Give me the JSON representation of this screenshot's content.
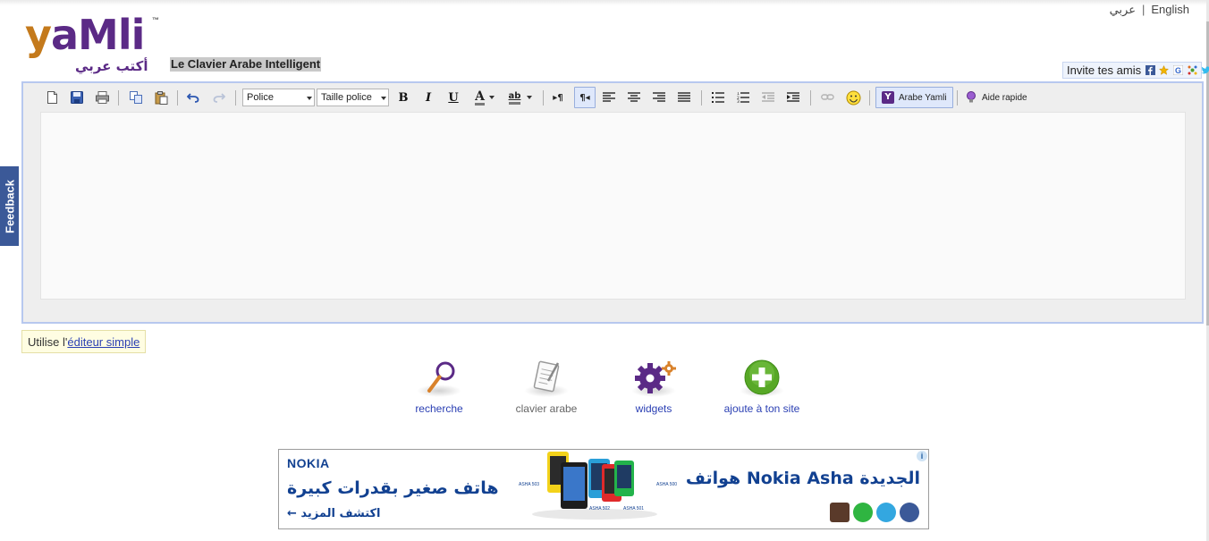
{
  "lang": {
    "arabic": "عربي",
    "separator": "|",
    "english": "English"
  },
  "logo": {
    "y": "y",
    "rest": "aMli",
    "tm": "™",
    "arabic": "أكتب عربي"
  },
  "tagline": "Le Clavier Arabe Intelligent",
  "invite": {
    "label": "Invite tes amis",
    "icons": [
      "facebook-icon",
      "star-icon",
      "google-icon",
      "share-icon",
      "twitter-icon"
    ]
  },
  "toolbar": {
    "font_select": "Police",
    "size_select": "Taille police",
    "bold": "B",
    "italic": "I",
    "underline": "U",
    "font_color": "A",
    "highlight": "ab",
    "yamli_button": "Arabe Yamli",
    "yamli_logo": "Y",
    "help_button": "Aide rapide",
    "icons": [
      "new-document-icon",
      "save-icon",
      "print-icon",
      "copy-icon",
      "paste-icon",
      "undo-icon",
      "redo-icon",
      "ltr-icon",
      "rtl-icon",
      "align-left-icon",
      "align-center-icon",
      "align-right-icon",
      "justify-icon",
      "bullet-list-icon",
      "numbered-list-icon",
      "outdent-icon",
      "indent-icon",
      "link-icon",
      "smiley-icon"
    ]
  },
  "feedback": "Feedback",
  "simple_editor": {
    "prefix": "Utilise l'",
    "link": "éditeur simple"
  },
  "features": [
    {
      "label": "recherche"
    },
    {
      "label": "clavier arabe"
    },
    {
      "label": "widgets"
    },
    {
      "label": "ajoute à ton site"
    }
  ],
  "ad": {
    "brand": "NOKIA",
    "headline_left": "هاتف صغير بقدرات كبيرة",
    "cta": "← اكتشف المزيد",
    "headline_right": "هواتف Nokia Asha الجديدة",
    "info": "i",
    "models": [
      "ASHA 503",
      "ASHA 502",
      "ASHA 501",
      "ASHA 500"
    ],
    "colors": {
      "brand_blue": "#124191"
    }
  },
  "colors": {
    "accent_purple": "#5b2a86",
    "logo_orange": "#c47a1c",
    "link_blue": "#2a3fb3",
    "feedback_blue": "#3b5998"
  }
}
